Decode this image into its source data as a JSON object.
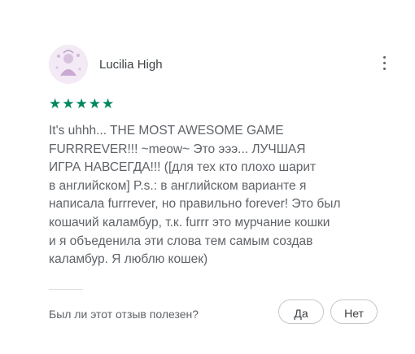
{
  "review": {
    "author": "Lucilia High",
    "rating": 5,
    "stars": "★★★★★",
    "text_lines": [
      "It's uhhh... THE MOST AWESOME GAME",
      "FURRREVER!!! ~meow~ Это эээ... ЛУЧШАЯ",
      "ИГРА НАВСЕГДА!!! ([для тех кто плохо шарит",
      "в английском] P.s.: в английском варианте я",
      "написала furrrever, но правильно forever! Это был",
      "кошачий каламбур, т.к. furrr это мурчание кошки",
      "и я объеденила эти слова тем самым создав",
      "каламбур. Я люблю кошек)"
    ]
  },
  "helpful": {
    "question": "Был ли этот отзыв полезен?",
    "yes_label": "Да",
    "no_label": "Нет"
  },
  "icons": {
    "more": "more-vert-icon",
    "star": "star-icon"
  },
  "colors": {
    "star": "#01875f",
    "text": "#5f6368"
  }
}
